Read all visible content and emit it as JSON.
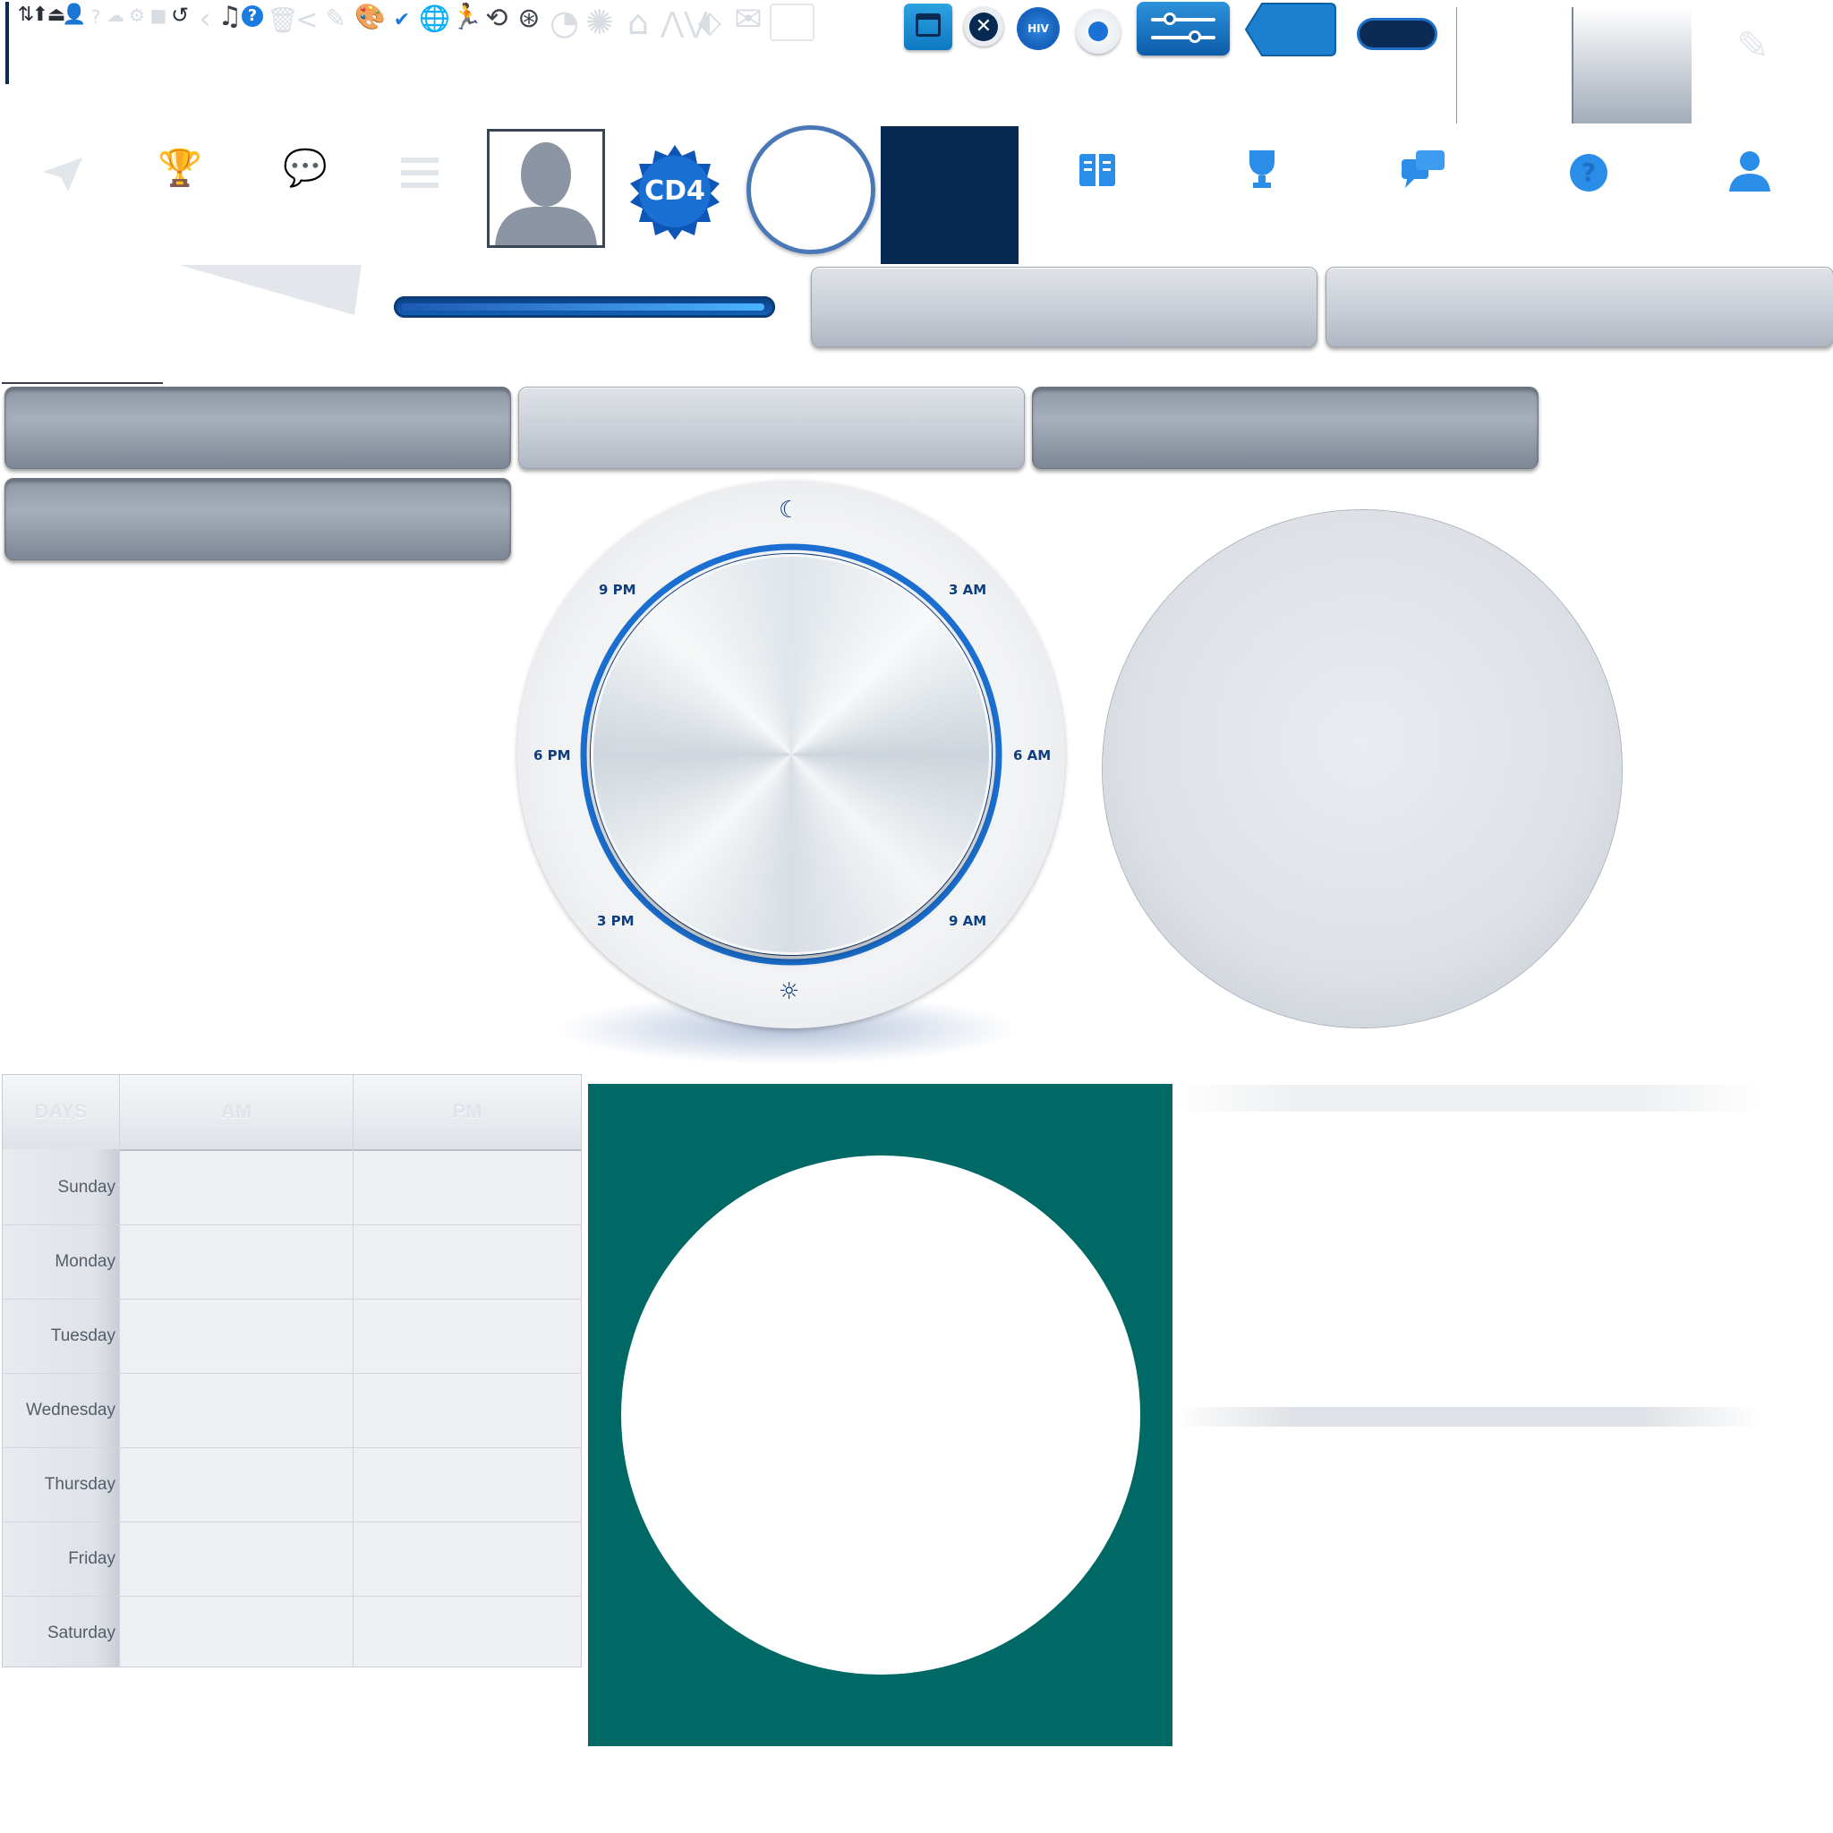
{
  "toolbar": {
    "icons": [
      "cursor-bar-icon",
      "sort-arrows-icon",
      "upload-icon",
      "eject-icon",
      "add-user-icon",
      "question-circle-icon",
      "cloud-icon",
      "gear-icon",
      "square-icon",
      "refresh-icon",
      "chevron-left-icon",
      "music-note-icon",
      "help-circle-icon",
      "trash-icon",
      "share-icon",
      "edit-icon",
      "palette-icon",
      "checkmark-icon",
      "globe-icon",
      "runner-icon",
      "history-icon",
      "film-reel-icon",
      "gauge-icon",
      "badge-gear-icon",
      "home-icon",
      "chart-line-icon",
      "tag-icon",
      "mail-icon",
      "id-card-icon"
    ]
  },
  "badges": {
    "hiv": "HIV",
    "cd4": "CD4"
  },
  "nav_icons": [
    "book-icon",
    "trophy-icon",
    "chat-icon",
    "question-icon",
    "user-icon"
  ],
  "faded_nav_icons": [
    "send-icon",
    "trophy-icon",
    "chat-icon",
    "menu-icon"
  ],
  "dial": {
    "labels": {
      "top_left": "9 PM",
      "top_right": "3 AM",
      "mid_left": "6 PM",
      "mid_right": "6 AM",
      "bot_left": "3 PM",
      "bot_right": "9 AM"
    }
  },
  "schedule": {
    "headers": [
      "DAYS",
      "AM",
      "PM"
    ],
    "days": [
      "Sunday",
      "Monday",
      "Tuesday",
      "Wednesday",
      "Thursday",
      "Friday",
      "Saturday"
    ]
  },
  "colors": {
    "navy": "#062a52",
    "accent": "#1976d2",
    "teal": "#006966"
  }
}
